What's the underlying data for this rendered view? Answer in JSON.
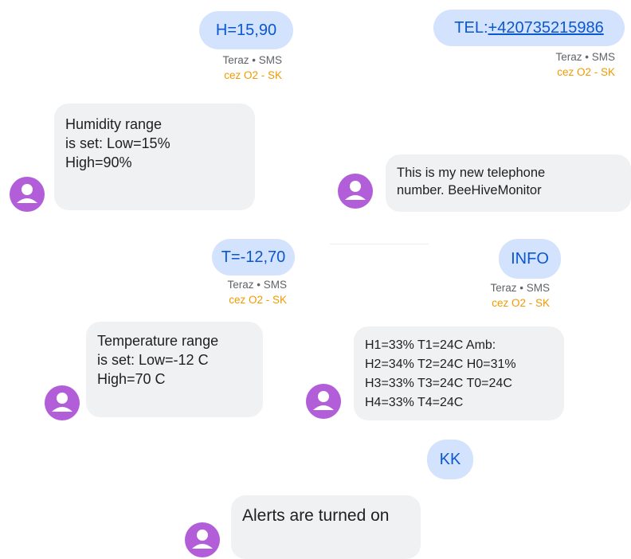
{
  "colors": {
    "sent_bubble": "#d3e3fd",
    "sent_text": "#0b57d0",
    "received_bubble": "#f0f1f3",
    "avatar": "#b15ed8",
    "carrier_text": "#f29900",
    "meta_text": "#5f6368"
  },
  "icons": {
    "avatar": "person-avatar-icon"
  },
  "left_thread": {
    "sent_1": {
      "text": "H=15,90",
      "time": "Teraz • SMS",
      "carrier": "cez O2 - SK"
    },
    "received_1": {
      "lines": [
        "Humidity range",
        "is set: Low=15%",
        "High=90%"
      ]
    },
    "sent_2": {
      "text": "T=-12,70",
      "time": "Teraz • SMS",
      "carrier": "cez O2 - SK"
    },
    "received_2": {
      "lines": [
        "Temperature range",
        "is set: Low=-12 C",
        "High=70 C"
      ]
    },
    "received_3": {
      "lines": [
        "Alerts are turned on"
      ]
    }
  },
  "right_thread": {
    "sent_1": {
      "prefix": "TEL:",
      "number": "+420735215986",
      "time": "Teraz • SMS",
      "carrier": "cez O2 - SK"
    },
    "received_1": {
      "lines": [
        "This is my new telephone",
        "number. BeeHiveMonitor"
      ]
    },
    "sent_2": {
      "text": "INFO",
      "time": "Teraz • SMS",
      "carrier": "cez O2 - SK"
    },
    "received_2": {
      "lines": [
        "H1=33% T1=24C  Amb:",
        "H2=34% T2=24C H0=31%",
        "H3=33% T3=24C T0=24C",
        "H4=33% T4=24C"
      ]
    },
    "sent_3": {
      "text": "KK"
    }
  }
}
